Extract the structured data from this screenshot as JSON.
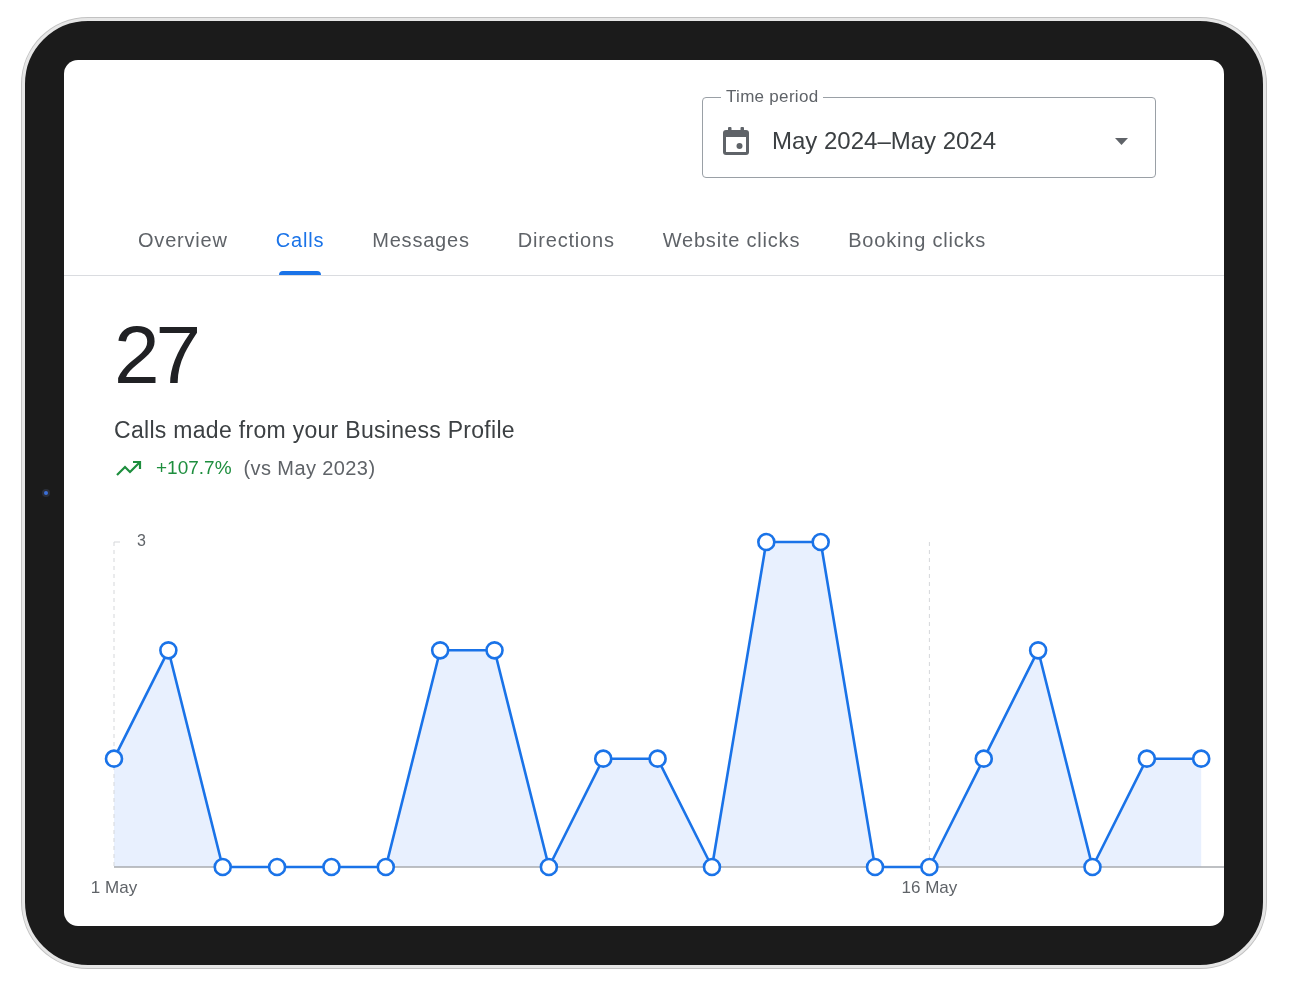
{
  "time_period": {
    "label": "Time period",
    "value": "May 2024–May 2024"
  },
  "tabs": [
    {
      "label": "Overview",
      "selected": false
    },
    {
      "label": "Calls",
      "selected": true
    },
    {
      "label": "Messages",
      "selected": false
    },
    {
      "label": "Directions",
      "selected": false
    },
    {
      "label": "Website clicks",
      "selected": false
    },
    {
      "label": "Booking clicks",
      "selected": false
    }
  ],
  "summary": {
    "total": "27",
    "description": "Calls made from your Business Profile",
    "rising": true,
    "change": "+107.7%",
    "comparison": "(vs May 2023)"
  },
  "chart": {
    "chart_data": {
      "type": "area",
      "categories": [
        "1 May",
        null,
        null,
        null,
        null,
        null,
        null,
        null,
        null,
        null,
        null,
        null,
        null,
        null,
        null,
        "16 May",
        null,
        null,
        null,
        null,
        null
      ],
      "values": [
        1,
        2,
        0,
        0,
        0,
        0,
        2,
        2,
        0,
        1,
        1,
        0,
        3,
        3,
        0,
        0,
        1,
        2,
        0,
        1,
        1
      ],
      "ylim": [
        0,
        3
      ],
      "yticks": [
        {
          "value": 3,
          "label": "3"
        }
      ]
    }
  }
}
